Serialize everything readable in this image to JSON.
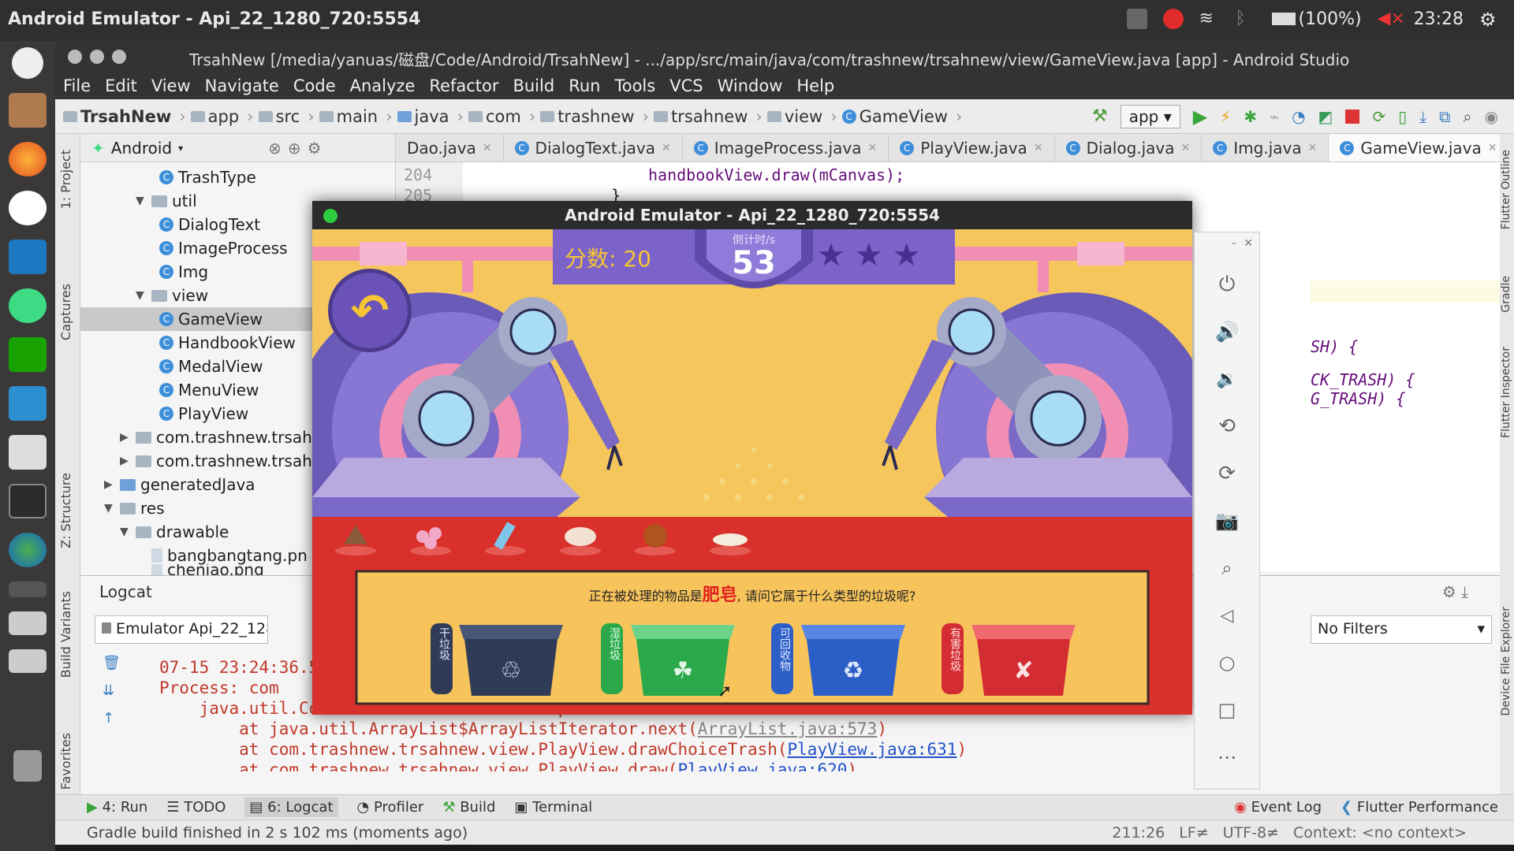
{
  "topbar": {
    "title": "Android Emulator - Api_22_1280_720:5554",
    "battery": "(100%)",
    "clock": "23:28"
  },
  "studio": {
    "window_title": "TrsahNew [/media/yanuas/磁盘/Code/Android/TrsahNew] - .../app/src/main/java/com/trashnew/trsahnew/view/GameView.java [app] - Android Studio",
    "menu": [
      "File",
      "Edit",
      "View",
      "Navigate",
      "Code",
      "Analyze",
      "Refactor",
      "Build",
      "Run",
      "Tools",
      "VCS",
      "Window",
      "Help"
    ],
    "breadcrumb": [
      "TrsahNew",
      "app",
      "src",
      "main",
      "java",
      "com",
      "trashnew",
      "trsahnew",
      "view",
      "GameView"
    ],
    "run_config": "app",
    "project_view": "Android",
    "tree": [
      {
        "label": "TrashType",
        "type": "class"
      },
      {
        "label": "util",
        "type": "folder"
      },
      {
        "label": "DialogText",
        "type": "class"
      },
      {
        "label": "ImageProcess",
        "type": "class"
      },
      {
        "label": "Img",
        "type": "class"
      },
      {
        "label": "view",
        "type": "folder"
      },
      {
        "label": "GameView",
        "type": "class"
      },
      {
        "label": "HandbookView",
        "type": "class"
      },
      {
        "label": "MedalView",
        "type": "class"
      },
      {
        "label": "MenuView",
        "type": "class"
      },
      {
        "label": "PlayView",
        "type": "class"
      },
      {
        "label": "com.trashnew.trsah",
        "type": "folder"
      },
      {
        "label": "com.trashnew.trsah",
        "type": "folder"
      },
      {
        "label": "generatedJava",
        "type": "folder"
      },
      {
        "label": "res",
        "type": "folder"
      },
      {
        "label": "drawable",
        "type": "folder"
      },
      {
        "label": "bangbangtang.pn",
        "type": "file"
      },
      {
        "label": "chenjao.png",
        "type": "file"
      }
    ],
    "tabs": [
      "Dao.java",
      "DialogText.java",
      "ImageProcess.java",
      "PlayView.java",
      "Dialog.java",
      "Img.java",
      "GameView.java"
    ],
    "active_tab": "GameView.java",
    "line_numbers": [
      "204",
      "205"
    ],
    "code": {
      "line1": "handbookView.draw(mCanvas);",
      "line2": "}",
      "frag1": "SH) {",
      "frag2": "CK_TRASH) {",
      "frag3": "G_TRASH) {"
    },
    "left_tools": [
      "1: Project",
      "Captures",
      "Z: Structure",
      "Build Variants",
      "2: Favorites"
    ],
    "right_tools": [
      "Flutter Outline",
      "Gradle",
      "Flutter Inspector",
      "Device File Explorer"
    ]
  },
  "logcat": {
    "title": "Logcat",
    "device": "Emulator Api_22_128(",
    "filter": "No Filters",
    "lines": [
      "07-15 23:24:36.5",
      "    Process: com",
      "    java.util.ConcurrentModificationException",
      "        at java.util.ArrayList$ArrayListIterator.next(",
      "        at com.trashnew.trsahnew.view.PlayView.drawChoiceTrash(",
      "        at com.trashnew.trsahnew.view.PlayView.draw("
    ],
    "links": [
      "ArrayList.java:573",
      "PlayView.java:631",
      "PlayView.java:620"
    ],
    "closers": [
      ")",
      ")",
      ")"
    ]
  },
  "bottom_tools": [
    "4: Run",
    "TODO",
    "6: Logcat",
    "Profiler",
    "Build",
    "Terminal",
    "Event Log",
    "Flutter Performance"
  ],
  "status": {
    "message": "Gradle build finished in 2 s 102 ms (moments ago)",
    "position": "211:26",
    "line_sep": "LF≠",
    "encoding": "UTF-8≠",
    "context": "Context: <no context>"
  },
  "emulator": {
    "title": "Android Emulator - Api_22_1280_720:5554",
    "score_label": "分数: 20",
    "timer_label": "倒计时/s",
    "timer_value": "53",
    "stars": 3,
    "prompt_prefix": "正在被处理的物品是",
    "prompt_item": "肥皂",
    "prompt_suffix": ", 请问它属于什么类型的垃圾呢?",
    "bins": [
      {
        "label": "干垃圾",
        "color": "#2f3b57"
      },
      {
        "label": "湿垃圾",
        "color": "#2aa84a"
      },
      {
        "label": "可回收物",
        "color": "#2c5ec7"
      },
      {
        "label": "有害垃圾",
        "color": "#d32d33"
      }
    ],
    "colors": {
      "bg": "#f5c65c",
      "purple": "#7b63c9",
      "belt": "#d9302c",
      "panel": "#f7c45c"
    }
  }
}
